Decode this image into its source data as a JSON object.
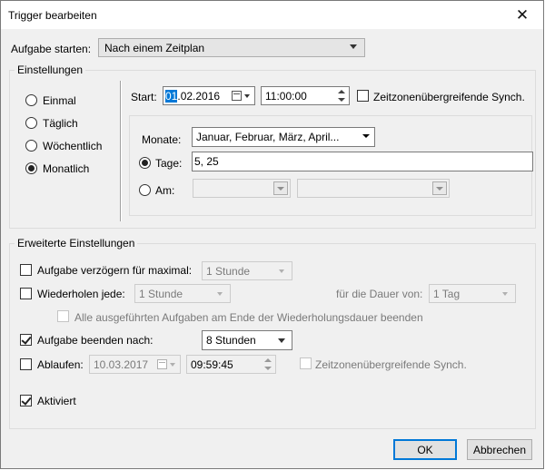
{
  "window": {
    "title": "Trigger bearbeiten",
    "close_glyph": "✕"
  },
  "schedule": {
    "label": "Aufgabe starten:",
    "value": "Nach einem Zeitplan"
  },
  "settings": {
    "title": "Einstellungen",
    "radios": [
      {
        "label": "Einmal",
        "checked": false
      },
      {
        "label": "Täglich",
        "checked": false
      },
      {
        "label": "Wöchentlich",
        "checked": false
      },
      {
        "label": "Monatlich",
        "checked": true
      }
    ],
    "start_label": "Start:",
    "start_date_selected": "01",
    "start_date_rest": ".02.2016",
    "start_time": "11:00:00",
    "sync_label": "Zeitzonenübergreifende Synch.",
    "sync_checked": false,
    "months_label": "Monate:",
    "months_value": "Januar, Februar, März, April...",
    "days_label": "Tage:",
    "days_value": "5, 25",
    "days_checked": true,
    "on_label": "Am:",
    "on_checked": false
  },
  "advanced": {
    "title": "Erweiterte Einstellungen",
    "delay_label": "Aufgabe verzögern für maximal:",
    "delay_value": "1 Stunde",
    "delay_checked": false,
    "repeat_label": "Wiederholen jede:",
    "repeat_value": "1 Stunde",
    "repeat_checked": false,
    "duration_label": "für die Dauer von:",
    "duration_value": "1 Tag",
    "stop_all_label": "Alle ausgeführten Aufgaben am Ende der Wiederholungsdauer beenden",
    "stop_all_checked": false,
    "end_after_label": "Aufgabe beenden nach:",
    "end_after_value": "8 Stunden",
    "end_after_checked": true,
    "expire_label": "Ablaufen:",
    "expire_date": "10.03.2017",
    "expire_time": "09:59:45",
    "expire_checked": false,
    "expire_sync_label": "Zeitzonenübergreifende Synch.",
    "expire_sync_checked": false,
    "enabled_label": "Aktiviert",
    "enabled_checked": true
  },
  "buttons": {
    "ok": "OK",
    "cancel": "Abbrechen"
  },
  "colors": {
    "accent": "#0078d7",
    "dialog_bg": "#f0f0f0",
    "disabled_text": "#7a7a7a"
  }
}
